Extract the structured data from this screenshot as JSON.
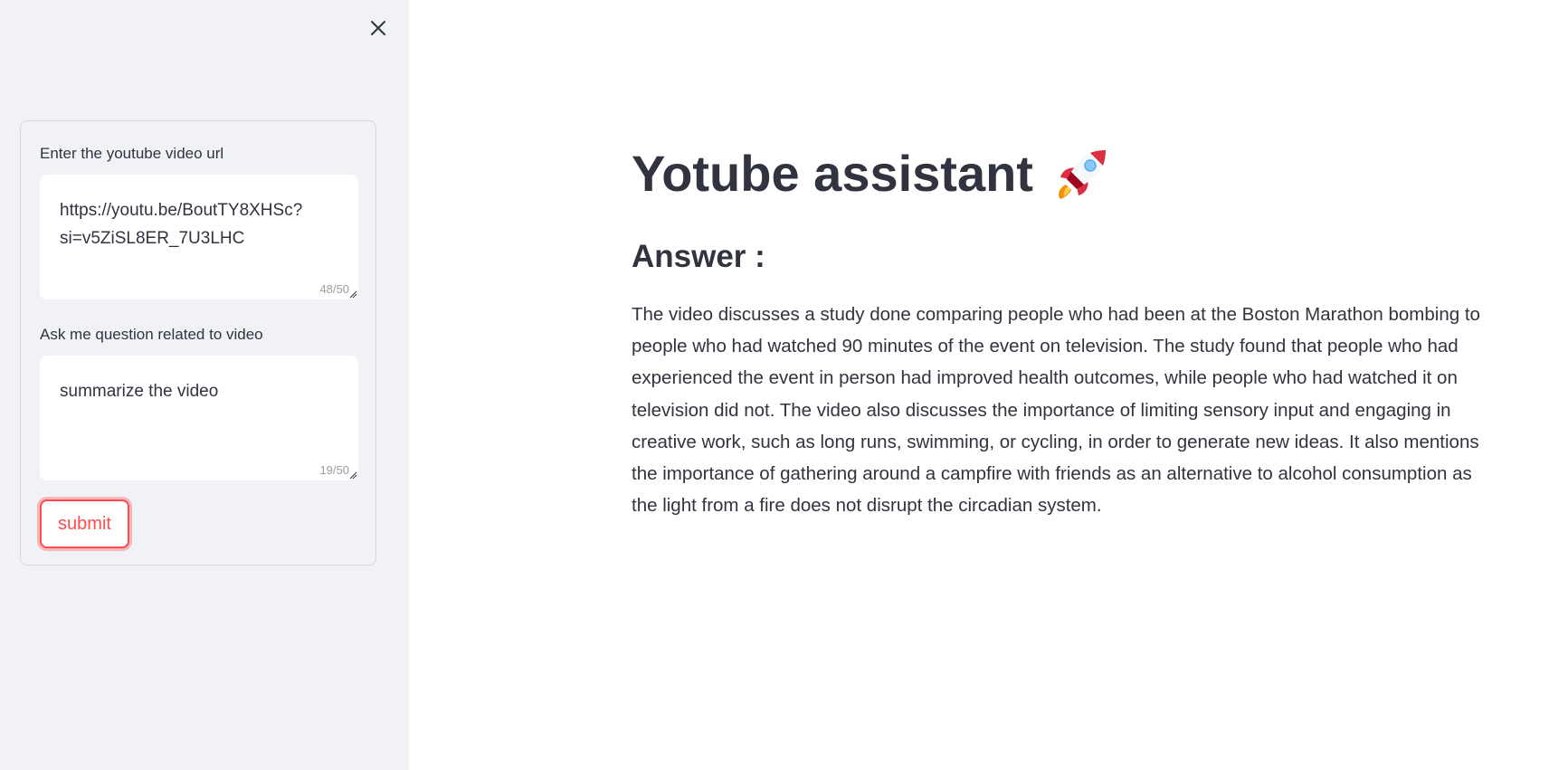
{
  "sidebar": {
    "url_field": {
      "label": "Enter the youtube video url",
      "value": "https://youtu.be/BoutTY8XHSc?si=v5ZiSL8ER_7U3LHC",
      "char_count": "48/50"
    },
    "question_field": {
      "label": "Ask me question related to video",
      "value": "summarize the video",
      "char_count": "19/50"
    },
    "submit_label": "submit",
    "close_icon": "close-icon"
  },
  "main": {
    "title": "Yotube assistant",
    "title_icon": "rocket-icon",
    "answer_heading": "Answer :",
    "answer_text": "The video discusses a study done comparing people who had been at the Boston Marathon bombing to people who had watched 90 minutes of the event on television. The study found that people who had experienced the event in person had improved health outcomes, while people who had watched it on television did not. The video also discusses the importance of limiting sensory input and engaging in creative work, such as long runs, swimming, or cycling, in order to generate new ideas. It also mentions the importance of gathering around a campfire with friends as an alternative to alcohol consumption as the light from a fire does not disrupt the circadian system."
  },
  "colors": {
    "sidebar_bg": "#f0f2f6",
    "accent": "#ff4b4b",
    "text": "#31333f"
  }
}
